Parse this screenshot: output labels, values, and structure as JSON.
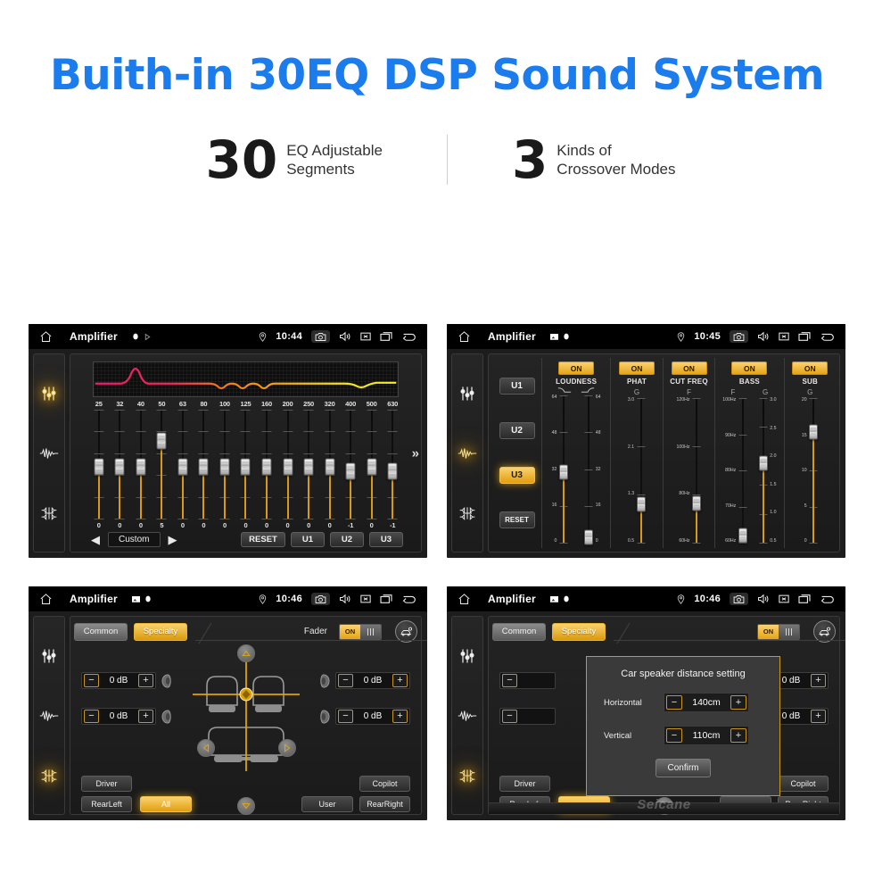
{
  "hero": {
    "title": "Buith-in 30EQ DSP Sound System",
    "stats": [
      {
        "number": "30",
        "line1": "EQ Adjustable",
        "line2": "Segments"
      },
      {
        "number": "3",
        "line1": "Kinds of",
        "line2": "Crossover Modes"
      }
    ]
  },
  "colors": {
    "title_blue": "#1b7ced",
    "accent_amber": "#e5a416",
    "panel_dark": "#1d1d1d"
  },
  "panels": {
    "eq": {
      "status": {
        "title": "Amplifier",
        "time": "10:44"
      },
      "rail": [
        "equalizer-icon",
        "waveform-icon",
        "balance-icon"
      ],
      "active_rail": "equalizer-icon",
      "frequencies": [
        "25",
        "32",
        "40",
        "50",
        "63",
        "80",
        "100",
        "125",
        "160",
        "200",
        "250",
        "320",
        "400",
        "500",
        "630"
      ],
      "values": [
        "0",
        "0",
        "0",
        "5",
        "0",
        "0",
        "0",
        "0",
        "0",
        "0",
        "0",
        "0",
        "-1",
        "0",
        "-1"
      ],
      "preset": "Custom",
      "prev_label": "◀",
      "next_label": "▶",
      "reset_label": "RESET",
      "user_presets": [
        "U1",
        "U2",
        "U3"
      ],
      "more_label": "»"
    },
    "crossover": {
      "status": {
        "title": "Amplifier",
        "time": "10:45"
      },
      "presets": [
        "U1",
        "U2",
        "U3"
      ],
      "active_preset": "U3",
      "reset_label": "RESET",
      "columns": [
        {
          "name": "LOUDNESS",
          "state": "ON",
          "sliders": [
            {
              "param": "",
              "scale": [
                "64",
                "48",
                "32",
                "16",
                "0"
              ],
              "scale_side": "left",
              "pos": 0.52
            },
            {
              "param": "",
              "scale": [
                "64",
                "48",
                "32",
                "16",
                "0"
              ],
              "scale_side": "right",
              "pos": 0.95
            }
          ]
        },
        {
          "name": "PHAT",
          "state": "ON",
          "sliders": [
            {
              "param": "G",
              "scale": [
                "3.0",
                "2.1",
                "1.3",
                "0.5"
              ],
              "scale_side": "left",
              "pos": 0.73
            }
          ]
        },
        {
          "name": "CUT FREQ",
          "state": "ON",
          "sliders": [
            {
              "param": "F",
              "scale": [
                "120Hz",
                "100Hz",
                "80Hz",
                "60Hz"
              ],
              "scale_side": "left",
              "pos": 0.72
            }
          ]
        },
        {
          "name": "BASS",
          "state": "ON",
          "sliders": [
            {
              "param": "F",
              "scale": [
                "100Hz",
                "90Hz",
                "80Hz",
                "70Hz",
                "60Hz"
              ],
              "scale_side": "left",
              "pos": 0.94
            },
            {
              "param": "G",
              "scale": [
                "3.0",
                "2.5",
                "2.0",
                "1.5",
                "1.0",
                "0.5"
              ],
              "scale_side": "right",
              "pos": 0.45
            }
          ]
        },
        {
          "name": "SUB",
          "state": "ON",
          "sliders": [
            {
              "param": "G",
              "scale": [
                "20",
                "15",
                "10",
                "5",
                "0"
              ],
              "scale_side": "left",
              "pos": 0.24
            }
          ]
        }
      ]
    },
    "fader": {
      "status": {
        "title": "Amplifier",
        "time": "10:46"
      },
      "tabs": [
        {
          "label": "Common",
          "active": false
        },
        {
          "label": "Specialty",
          "active": true
        }
      ],
      "fader_label": "Fader",
      "fader_state": "ON",
      "car_icon": "car-settings-icon",
      "gains": [
        {
          "position": "front-left",
          "value": "0 dB"
        },
        {
          "position": "front-right",
          "value": "0 dB"
        },
        {
          "position": "rear-left",
          "value": "0 dB"
        },
        {
          "position": "rear-right",
          "value": "0 dB"
        }
      ],
      "minus_label": "−",
      "plus_label": "+",
      "seat_buttons_left": [
        "Driver",
        "RearLeft"
      ],
      "seat_buttons_right": [
        "Copilot",
        "RearRight"
      ],
      "center_buttons": [
        "All",
        "User"
      ],
      "active_seat": "All"
    },
    "fader_dialog": {
      "status": {
        "title": "Amplifier",
        "time": "10:46"
      },
      "tabs": [
        {
          "label": "Common",
          "active": false
        },
        {
          "label": "Specialty",
          "active": true
        }
      ],
      "fader_state": "ON",
      "dialog": {
        "title": "Car speaker distance setting",
        "rows": [
          {
            "label": "Horizontal",
            "value": "140cm"
          },
          {
            "label": "Vertical",
            "value": "110cm"
          }
        ],
        "confirm_label": "Confirm",
        "minus_label": "−",
        "plus_label": "+"
      },
      "gains": [
        {
          "position": "front-right",
          "value": "0 dB"
        },
        {
          "position": "rear-right",
          "value": "0 dB"
        }
      ],
      "seat_buttons_left": [
        "Driver",
        "RearLef."
      ],
      "seat_buttons_right": [
        "Copilot",
        "RearRight"
      ],
      "watermark": "Seicane"
    }
  }
}
